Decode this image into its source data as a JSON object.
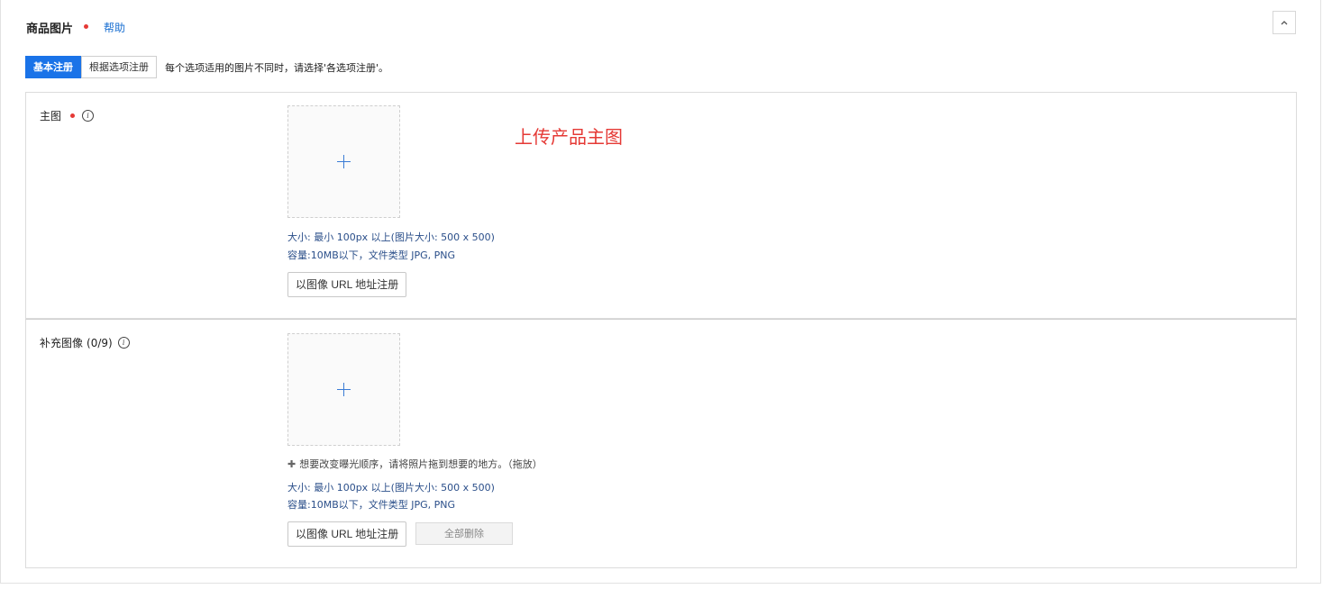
{
  "header": {
    "title": "商品图片",
    "help_label": "帮助"
  },
  "tabs": [
    {
      "label": "基本注册",
      "active": true
    },
    {
      "label": "根据选项注册",
      "active": false
    }
  ],
  "tab_hint": "每个选项适用的图片不同时，请选择'各选项注册'。",
  "main_image": {
    "label": "主图",
    "size_note": "大小: 最小 100px 以上(图片大小: 500 x 500)",
    "capacity_note": "容量:10MB以下，文件类型 JPG, PNG",
    "url_button": "以图像 URL 地址注册"
  },
  "extra_images": {
    "label": "补充图像",
    "count": "(0/9)",
    "drag_note": "想要改变曝光顺序，请将照片拖到想要的地方。（拖放）",
    "size_note": "大小: 最小 100px 以上(图片大小: 500 x 500)",
    "capacity_note": "容量:10MB以下，文件类型 JPG, PNG",
    "url_button": "以图像 URL 地址注册",
    "delete_all_button": "全部删除"
  },
  "annotation": "上传产品主图",
  "icons": {
    "required": "required-dot-icon",
    "info": "info-icon",
    "collapse": "chevron-up-icon",
    "add": "plus-icon",
    "move": "move-icon"
  },
  "colors": {
    "accent": "#1a73e8",
    "required": "#e53935",
    "note_text": "#2b4f8a",
    "annotation": "#e53935"
  }
}
